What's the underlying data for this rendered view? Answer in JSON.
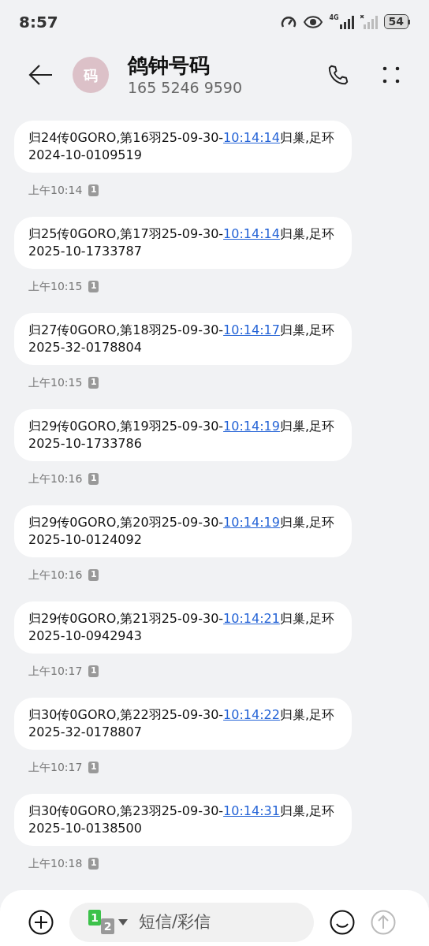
{
  "status_bar": {
    "time": "8:57",
    "network": "4G",
    "battery": "54"
  },
  "header": {
    "avatar": "码",
    "name": "鸽钟号码",
    "number": "165 5246 9590"
  },
  "messages": [
    {
      "before": "归24传0GORO,第16羽25-09-30-",
      "link": "10:14:14",
      "after": "归巢,足环",
      "ring": "2024-10-0109519",
      "time": "上午10:14",
      "sim": "1"
    },
    {
      "before": "归25传0GORO,第17羽25-09-30-",
      "link": "10:14:14",
      "after": "归巢,足环",
      "ring": "2025-10-1733787",
      "time": "上午10:15",
      "sim": "1"
    },
    {
      "before": "归27传0GORO,第18羽25-09-30-",
      "link": "10:14:17",
      "after": "归巢,足环",
      "ring": "2025-32-0178804",
      "time": "上午10:15",
      "sim": "1"
    },
    {
      "before": "归29传0GORO,第19羽25-09-30-",
      "link": "10:14:19",
      "after": "归巢,足环",
      "ring": "2025-10-1733786",
      "time": "上午10:16",
      "sim": "1"
    },
    {
      "before": "归29传0GORO,第20羽25-09-30-",
      "link": "10:14:19",
      "after": "归巢,足环",
      "ring": "2025-10-0124092",
      "time": "上午10:16",
      "sim": "1"
    },
    {
      "before": "归29传0GORO,第21羽25-09-30-",
      "link": "10:14:21",
      "after": "归巢,足环",
      "ring": "2025-10-0942943",
      "time": "上午10:17",
      "sim": "1"
    },
    {
      "before": "归30传0GORO,第22羽25-09-30-",
      "link": "10:14:22",
      "after": "归巢,足环",
      "ring": "2025-32-0178807",
      "time": "上午10:17",
      "sim": "1"
    },
    {
      "before": "归30传0GORO,第23羽25-09-30-",
      "link": "10:14:31",
      "after": "归巢,足环",
      "ring": "2025-10-0138500",
      "time": "上午10:18",
      "sim": "1"
    }
  ],
  "composer": {
    "sim_primary": "1",
    "sim_secondary": "2",
    "placeholder": "短信/彩信"
  }
}
